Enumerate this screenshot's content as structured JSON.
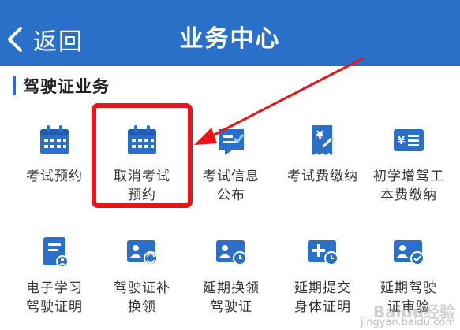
{
  "header": {
    "back_label": "返回",
    "title": "业务中心",
    "color": "#2a70c8"
  },
  "section": {
    "title": "驾驶证业务"
  },
  "items_row1": [
    {
      "label": "考试预约",
      "icon": "calendar-icon"
    },
    {
      "label": "取消考试\n预约",
      "icon": "calendar-icon"
    },
    {
      "label": "考试信息\n公布",
      "icon": "notice-icon"
    },
    {
      "label": "考试费缴纳",
      "icon": "receipt-icon"
    },
    {
      "label": "初学增驾工\n本费缴纳",
      "icon": "payment-card-icon"
    }
  ],
  "items_row2": [
    {
      "label": "电子学习\n驾驶证明",
      "icon": "certificate-icon"
    },
    {
      "label": "驾驶证补\n换领",
      "icon": "license-renew-icon"
    },
    {
      "label": "延期换领\n驾驶证",
      "icon": "license-clock-icon"
    },
    {
      "label": "延期提交\n身体证明",
      "icon": "add-clock-icon"
    },
    {
      "label": "延期驾驶\n证审验",
      "icon": "license-check-icon"
    }
  ],
  "annotation": {
    "highlight_color": "#e8151b"
  },
  "watermark": {
    "line1": "Baidu经验",
    "line2": "jingyan.baidu.com"
  }
}
